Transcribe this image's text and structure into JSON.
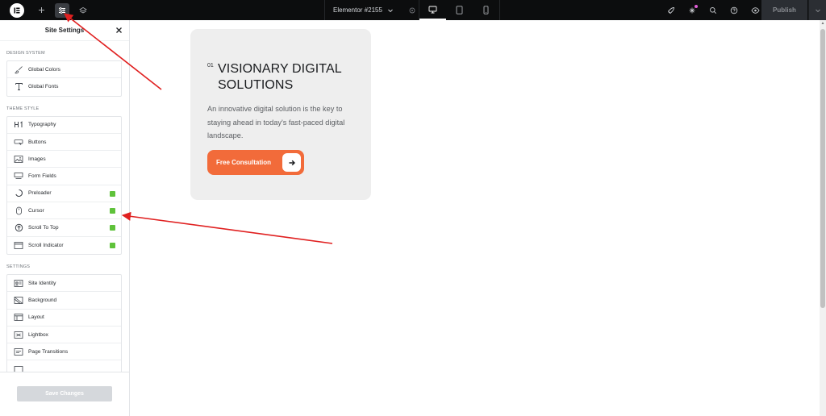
{
  "topbar": {
    "logo_icon": "elementor-logo-icon",
    "add_icon": "plus-icon",
    "site_settings_icon": "sliders-icon",
    "structure_icon": "layers-icon",
    "document_title": "Elementor #2155",
    "devices": [
      "desktop",
      "tablet",
      "mobile"
    ],
    "right_icons": [
      "rocket-icon",
      "sparkle-icon",
      "search-icon",
      "help-icon",
      "eye-icon"
    ],
    "publish_label": "Publish"
  },
  "sidebar": {
    "title": "Site Settings",
    "sections": [
      {
        "label": "DESIGN SYSTEM",
        "items": [
          {
            "label": "Global Colors",
            "icon": "brush-icon"
          },
          {
            "label": "Global Fonts",
            "icon": "typeface-icon"
          }
        ]
      },
      {
        "label": "THEME STYLE",
        "items": [
          {
            "label": "Typography",
            "icon": "heading-icon"
          },
          {
            "label": "Buttons",
            "icon": "button-icon"
          },
          {
            "label": "Images",
            "icon": "image-icon"
          },
          {
            "label": "Form Fields",
            "icon": "form-icon"
          },
          {
            "label": "Preloader",
            "icon": "spinner-icon",
            "badge": true
          },
          {
            "label": "Cursor",
            "icon": "mouse-icon",
            "badge": true
          },
          {
            "label": "Scroll To Top",
            "icon": "arrow-up-circle-icon",
            "badge": true
          },
          {
            "label": "Scroll Indicator",
            "icon": "window-icon",
            "badge": true
          }
        ]
      },
      {
        "label": "SETTINGS",
        "items": [
          {
            "label": "Site Identity",
            "icon": "id-card-icon"
          },
          {
            "label": "Background",
            "icon": "background-icon"
          },
          {
            "label": "Layout",
            "icon": "layout-icon"
          },
          {
            "label": "Lightbox",
            "icon": "lightbox-icon"
          },
          {
            "label": "Page Transitions",
            "icon": "transition-icon"
          }
        ]
      }
    ],
    "save_label": "Save Changes"
  },
  "card": {
    "number": "01",
    "heading": "VISIONARY DIGITAL SOLUTIONS",
    "description": "An innovative digital solution is the key to staying ahead in today's fast-paced digital landscape.",
    "cta_label": "Free Consultation"
  },
  "colors": {
    "accent": "#f26b3a",
    "annotation_arrow": "#e02020",
    "pro_badge": "#5fc23a",
    "topbar_bg": "#0c0d0e"
  }
}
